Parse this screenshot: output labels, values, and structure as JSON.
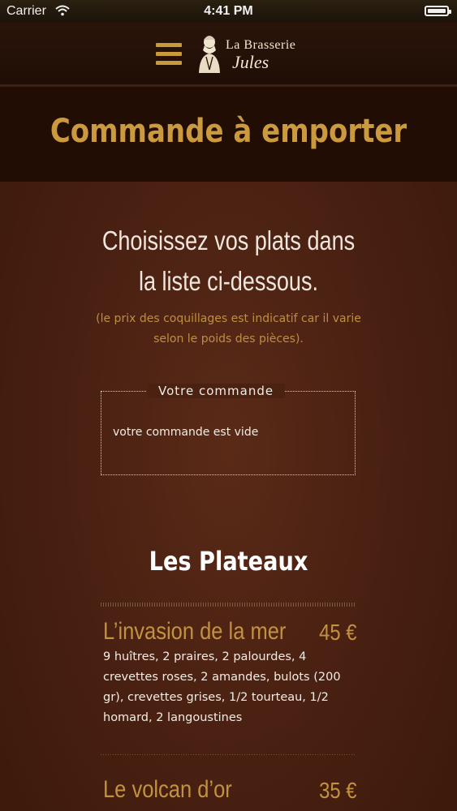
{
  "status_bar": {
    "carrier": "Carrier",
    "time": "4:41 PM"
  },
  "header": {
    "logo_line1": "La Brasserie",
    "logo_line2": "Jules"
  },
  "page": {
    "title": "Commande à emporter",
    "intro_line1": "Choisissez vos plats dans",
    "intro_line2": "la liste ci-dessous.",
    "intro_note": "(le prix des coquillages est indicatif car il varie selon le poids des pièces)."
  },
  "order": {
    "legend": "Votre commande",
    "empty_text": "votre commande est vide"
  },
  "menu": {
    "section_title": "Les Plateaux",
    "items": [
      {
        "name": "L’invasion de la mer",
        "price": "45 €",
        "description": "9 huîtres, 2 praires, 2 palourdes, 4 crevettes roses, 2 amandes, bulots (200 gr), crevettes grises, 1/2 tourteau, 1/2 homard, 2 langoustines"
      },
      {
        "name": "Le volcan d’or",
        "price": "35 €",
        "description": ""
      }
    ]
  }
}
